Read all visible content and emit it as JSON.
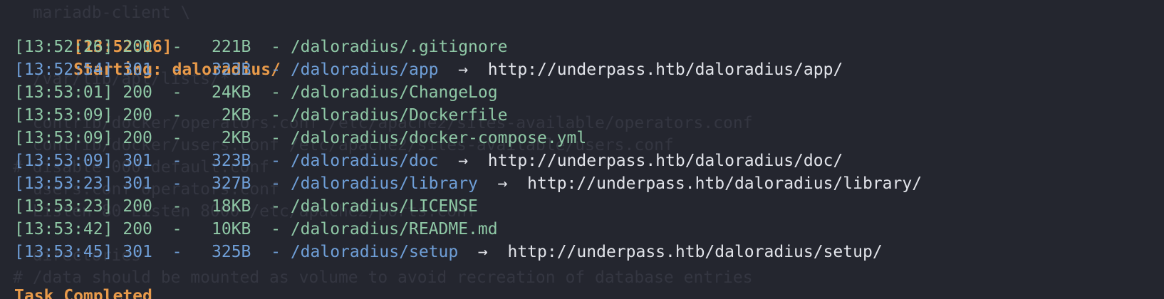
{
  "window": {
    "header_line": {
      "timestamp": "[13:52:16]",
      "text": "Starting: daloradius/"
    },
    "footer_text": "Task Completed"
  },
  "background_text": [
    "  mariadb-client \\",
    "",
    "",
    "  /var/lib/apt/lists/*",
    "",
    "  contrib/docker/operators.conf /etc/apache2/sites-available/operators.conf",
    "  contrib/docker/users.conf /etc/apache2/sites-available/users.conf",
    "# disable 000-default.conf",
    "  users.conf operators.conf",
    "  Listen 80 Listen 8000 /etc/apache2/ports.conf",
    "",
    "  directories",
    "# /data should be mounted as volume to avoid recreation of database entries"
  ],
  "results": [
    {
      "timestamp": "[13:52:26]",
      "status": "200",
      "size": "221B",
      "path": "/daloradius/.gitignore",
      "redirect": ""
    },
    {
      "timestamp": "[13:52:54]",
      "status": "301",
      "size": "323B",
      "path": "/daloradius/app",
      "redirect": "http://underpass.htb/daloradius/app/"
    },
    {
      "timestamp": "[13:53:01]",
      "status": "200",
      "size": "24KB",
      "path": "/daloradius/ChangeLog",
      "redirect": ""
    },
    {
      "timestamp": "[13:53:09]",
      "status": "200",
      "size": "2KB",
      "path": "/daloradius/Dockerfile",
      "redirect": ""
    },
    {
      "timestamp": "[13:53:09]",
      "status": "200",
      "size": "2KB",
      "path": "/daloradius/docker-compose.yml",
      "redirect": ""
    },
    {
      "timestamp": "[13:53:09]",
      "status": "301",
      "size": "323B",
      "path": "/daloradius/doc",
      "redirect": "http://underpass.htb/daloradius/doc/"
    },
    {
      "timestamp": "[13:53:23]",
      "status": "301",
      "size": "327B",
      "path": "/daloradius/library",
      "redirect": "http://underpass.htb/daloradius/library/"
    },
    {
      "timestamp": "[13:53:23]",
      "status": "200",
      "size": "18KB",
      "path": "/daloradius/LICENSE",
      "redirect": ""
    },
    {
      "timestamp": "[13:53:42]",
      "status": "200",
      "size": "10KB",
      "path": "/daloradius/README.md",
      "redirect": ""
    },
    {
      "timestamp": "[13:53:45]",
      "status": "301",
      "size": "325B",
      "path": "/daloradius/setup",
      "redirect": "http://underpass.htb/daloradius/setup/"
    }
  ],
  "symbols": {
    "dash": "-",
    "arrow": "->"
  },
  "colors": {
    "background": "#24262f",
    "orange": "#e89a4a",
    "green": "#8fc8a6",
    "blue": "#6f9fd8",
    "white": "#e2e4ea",
    "ghost": "#343641"
  }
}
